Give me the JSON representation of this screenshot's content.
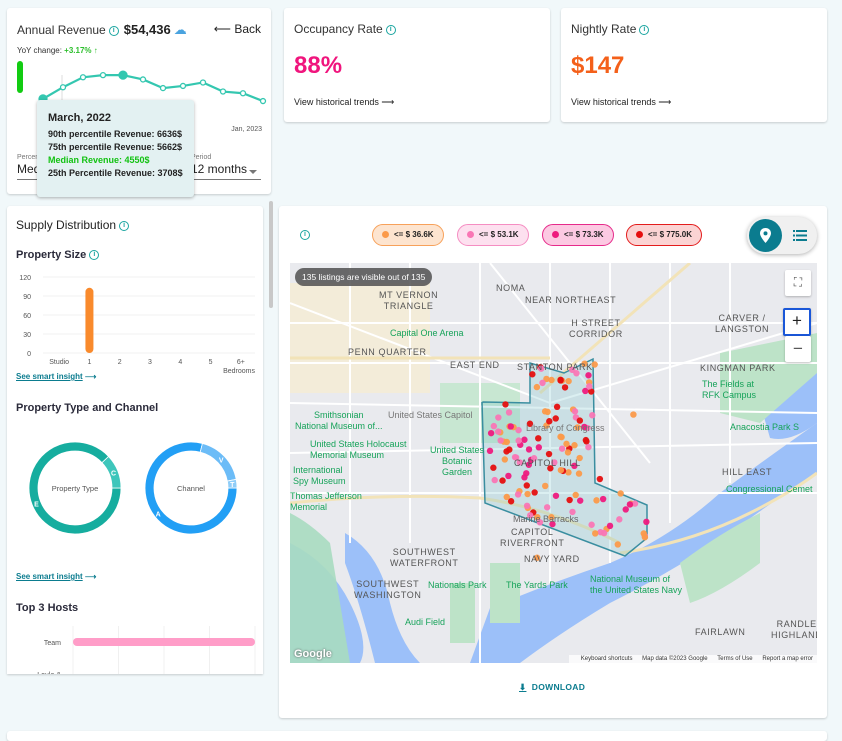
{
  "revenue_card": {
    "title": "Annual Revenue",
    "amount": "$54,436",
    "back_label": "Back",
    "yoy_label": "YoY change:",
    "yoy_value": "+3.17% ↑",
    "end_label": "Jan, 2023",
    "series_relative": [
      0.35,
      0.62,
      0.85,
      0.9,
      0.9,
      0.8,
      0.6,
      0.65,
      0.73,
      0.52,
      0.48,
      0.3
    ],
    "highlight_index": 0,
    "selects": [
      {
        "label": "Percentile",
        "value": "Median"
      },
      {
        "label": "Period",
        "value": "12 months"
      }
    ],
    "tooltip": {
      "title": "March, 2022",
      "rows": [
        {
          "text": "90th percentile Revenue: 6636$",
          "type": "normal"
        },
        {
          "text": "75th percentile Revenue: 5662$",
          "type": "normal"
        },
        {
          "text": "Median Revenue: 4550$",
          "type": "median"
        },
        {
          "text": "25th Percentile Revenue: 3708$",
          "type": "normal"
        }
      ]
    }
  },
  "occupancy": {
    "title": "Occupancy Rate",
    "value": "88%",
    "link": "View historical trends ⟶",
    "color": "#f0157d"
  },
  "nightly": {
    "title": "Nightly Rate",
    "value": "$147",
    "link": "View historical trends ⟶",
    "color": "#f4601a"
  },
  "supply": {
    "title": "Supply Distribution",
    "property_size": {
      "title": "Property Size",
      "y_ticks": [
        "120",
        "90",
        "60",
        "30",
        "0"
      ],
      "ylim": [
        0,
        120
      ],
      "categories": [
        "Studio",
        "1",
        "2",
        "3",
        "4",
        "5",
        "6+"
      ],
      "values": [
        0,
        103,
        0,
        0,
        0,
        0,
        0
      ],
      "x_axis_label": "Bedrooms",
      "bar_color": "#f98a2c"
    },
    "insight_link": "See smart insight",
    "type_channel": {
      "title": "Property Type and Channel",
      "property_type": {
        "center": "Property Type",
        "slices": [
          {
            "label": "E",
            "value": 88,
            "color": "#16ad9f"
          },
          {
            "label": "C",
            "value": 12,
            "color": "#3ec6bb"
          }
        ]
      },
      "channel": {
        "center": "Channel",
        "slices": [
          {
            "label": "A",
            "value": 79,
            "color": "#229ff5"
          },
          {
            "label": "V",
            "value": 18,
            "color": "#6cbcf7"
          },
          {
            "label": "T",
            "value": 3,
            "color": "#8fcdf8"
          }
        ]
      }
    },
    "top_hosts": {
      "title": "Top 3 Hosts",
      "hosts": [
        {
          "name": "Team",
          "value": 1.0
        },
        {
          "name": "Loule &",
          "value": 0
        }
      ],
      "bar_color": "#ff9dc8"
    }
  },
  "map": {
    "legend": [
      {
        "label": "<= $ 36.6K",
        "color": "#fb9a4a",
        "bg": "#fde4cf",
        "border": "#f7a15a"
      },
      {
        "label": "<= $ 53.1K",
        "color": "#f976b5",
        "bg": "#fde0ef",
        "border": "#f58dc2"
      },
      {
        "label": "<= $ 73.3K",
        "color": "#ee1a7e",
        "bg": "#fcc9e2",
        "border": "#e62a8a"
      },
      {
        "label": "<= $ 775.0K",
        "color": "#e50f0f",
        "bg": "#fbd3d3",
        "border": "#e31c1c"
      }
    ],
    "listing_badge": "135 listings are visible out of 135",
    "labels": [
      {
        "text": "MT VERNON\nTRIANGLE"
      },
      {
        "text": "NOMA"
      },
      {
        "text": "NEAR NORTHEAST"
      },
      {
        "text": "H STREET\nCORRIDOR"
      },
      {
        "text": "CARVER /\nLANGSTON"
      },
      {
        "text": "PENN QUARTER"
      },
      {
        "text": "EAST END"
      },
      {
        "text": "STANTON PARK"
      },
      {
        "text": "KINGMAN PARK"
      },
      {
        "text": "CAPITOL HILL"
      },
      {
        "text": "HILL EAST"
      },
      {
        "text": "CAPITOL\nRIVERFRONT"
      },
      {
        "text": "NAVY YARD"
      },
      {
        "text": "SOUTHWEST\nWATERFRONT"
      },
      {
        "text": "SOUTHWEST\nWASHINGTON"
      },
      {
        "text": "FAIRLAWN"
      },
      {
        "text": "RANDLE\nHIGHLAND"
      }
    ],
    "pois": [
      {
        "text": "Capital One Arena"
      },
      {
        "text": "Smithsonian\nNational Museum of..."
      },
      {
        "text": "United States Capitol"
      },
      {
        "text": "Library of Congress"
      },
      {
        "text": "United States Holocaust\nMemorial Museum"
      },
      {
        "text": "United States\nBotanic\nGarden"
      },
      {
        "text": "International\nSpy Museum"
      },
      {
        "text": "Thomas Jefferson\nMemorial"
      },
      {
        "text": "Marine Barracks"
      },
      {
        "text": "The Fields at\nRFK Campus"
      },
      {
        "text": "Anacostia Park S"
      },
      {
        "text": "Congressional Cemet"
      },
      {
        "text": "Nationals Park"
      },
      {
        "text": "The Yards Park"
      },
      {
        "text": "National Museum of\nthe United States Navy"
      },
      {
        "text": "Audi Field"
      }
    ],
    "attribution": [
      "Keyboard shortcuts",
      "Map data ©2023 Google",
      "Terms of Use",
      "Report a map error"
    ],
    "google_logo": "Google",
    "zoom_in": "+",
    "zoom_out": "−"
  },
  "download_label": "DOWNLOAD"
}
